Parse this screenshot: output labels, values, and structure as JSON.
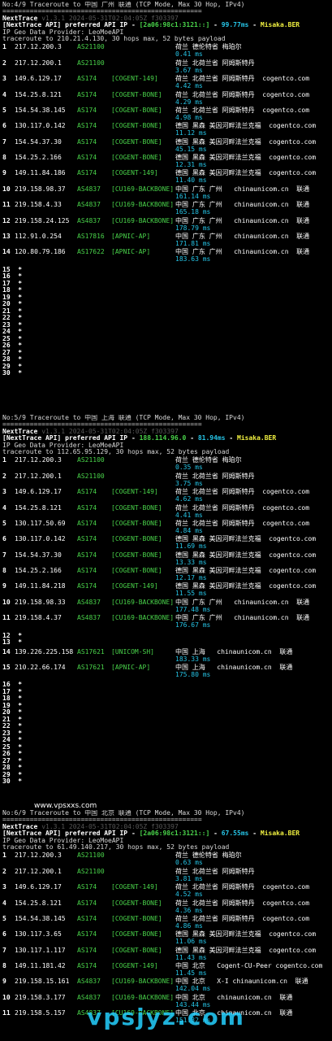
{
  "colors": {
    "background": "#000000",
    "latency": "#26c4e6",
    "asn": "#49d34a",
    "watermark": "#25d0ff"
  },
  "watermarks": {
    "small": "www.vpsxxs.com",
    "large": "vpsjyz.com"
  },
  "sections": [
    {
      "title": "No:4/9 Traceroute to 中国 广州 联通 (TCP Mode, Max 30 Hop, IPv4)",
      "separator": "===================================================",
      "brand": "NextTrace",
      "version": "v1.3.1 2024-05-31T02:04:05Z f303397",
      "api_line": "[NextTrace API] preferred API IP - [2a06:98c1:3121::] - 99.77ms - Misaka.BER",
      "provider": "IP Geo Data Provider: LeoMoeAPI",
      "trace_line": "traceroute to 210.21.4.130, 30 hops max, 52 bytes payload",
      "hops": [
        {
          "n": "1",
          "ip": "217.12.200.3",
          "asn": "AS21100",
          "tag": "",
          "geo": "荷兰 德伦特省 梅珀尔",
          "ms": "0.41 ms"
        },
        {
          "n": "2",
          "ip": "217.12.200.1",
          "asn": "AS21100",
          "tag": "",
          "geo": "荷兰 北荷兰省 阿姆斯特丹",
          "ms": "3.67 ms"
        },
        {
          "n": "3",
          "ip": "149.6.129.17",
          "asn": "AS174",
          "tag": "[COGENT-149]",
          "geo": "荷兰 北荷兰省 阿姆斯特丹  cogentco.com",
          "ms": "4.42 ms"
        },
        {
          "n": "4",
          "ip": "154.25.8.121",
          "asn": "AS174",
          "tag": "[COGENT-BONE]",
          "geo": "荷兰 北荷兰省 阿姆斯特丹  cogentco.com",
          "ms": "4.29 ms"
        },
        {
          "n": "5",
          "ip": "154.54.38.145",
          "asn": "AS174",
          "tag": "[COGENT-BONE]",
          "geo": "荷兰 北荷兰省 阿姆斯特丹  cogentco.com",
          "ms": "4.98 ms"
        },
        {
          "n": "6",
          "ip": "130.117.0.142",
          "asn": "AS174",
          "tag": "[COGENT-BONE]",
          "geo": "德国 黑森 美因河畔法兰克福  cogentco.com",
          "ms": "11.12 ms"
        },
        {
          "n": "7",
          "ip": "154.54.37.30",
          "asn": "AS174",
          "tag": "[COGENT-BONE]",
          "geo": "德国 黑森 美因河畔法兰克福  cogentco.com",
          "ms": "45.15 ms"
        },
        {
          "n": "8",
          "ip": "154.25.2.166",
          "asn": "AS174",
          "tag": "[COGENT-BONE]",
          "geo": "德国 黑森 美因河畔法兰克福  cogentco.com",
          "ms": "12.31 ms"
        },
        {
          "n": "9",
          "ip": "149.11.84.186",
          "asn": "AS174",
          "tag": "[COGENT-149]",
          "geo": "德国 黑森 美因河畔法兰克福  cogentco.com",
          "ms": "11.40 ms"
        },
        {
          "n": "10",
          "ip": "219.158.98.37",
          "asn": "AS4837",
          "tag": "[CU169-BACKBONE]",
          "geo": "中国 广东 广州   chinaunicom.cn  联通",
          "ms": "161.14 ms"
        },
        {
          "n": "11",
          "ip": "219.158.4.33",
          "asn": "AS4837",
          "tag": "[CU169-BACKBONE]",
          "geo": "中国 广东 广州   chinaunicom.cn  联通",
          "ms": "165.18 ms"
        },
        {
          "n": "12",
          "ip": "219.158.24.125",
          "asn": "AS4837",
          "tag": "[CU169-BACKBONE]",
          "geo": "中国 广东 广州   chinaunicom.cn  联通",
          "ms": "178.79 ms"
        },
        {
          "n": "13",
          "ip": "112.91.0.254",
          "asn": "AS17816",
          "tag": "[APNIC-AP]",
          "geo": "中国 广东 广州   chinaunicom.cn  联通",
          "ms": "171.81 ms"
        },
        {
          "n": "14",
          "ip": "120.80.79.186",
          "asn": "AS17622",
          "tag": "[APNIC-AP]",
          "geo": "中国 广东 广州   chinaunicom.cn  联通",
          "ms": "183.63 ms"
        }
      ],
      "stars": [
        "15",
        "16",
        "17",
        "18",
        "19",
        "20",
        "21",
        "22",
        "23",
        "24",
        "25",
        "26",
        "27",
        "28",
        "29",
        "30"
      ]
    },
    {
      "title": "No:5/9 Traceroute to 中国 上海 联通 (TCP Mode, Max 30 Hop, IPv4)",
      "separator": "===================================================",
      "brand": "NextTrace",
      "version": "v1.3.1 2024-05-31T02:04:05Z f303397",
      "api_line": "[NextTrace API] preferred API IP - 188.114.96.0 - 81.94ms - Misaka.BER",
      "provider": "IP Geo Data Provider: LeoMoeAPI",
      "trace_line": "traceroute to 112.65.95.129, 30 hops max, 52 bytes payload",
      "hops": [
        {
          "n": "1",
          "ip": "217.12.200.3",
          "asn": "AS21100",
          "tag": "",
          "geo": "荷兰 德伦特省 梅珀尔",
          "ms": "0.35 ms"
        },
        {
          "n": "2",
          "ip": "217.12.200.1",
          "asn": "AS21100",
          "tag": "",
          "geo": "荷兰 北荷兰省 阿姆斯特丹",
          "ms": "3.75 ms"
        },
        {
          "n": "3",
          "ip": "149.6.129.17",
          "asn": "AS174",
          "tag": "[COGENT-149]",
          "geo": "荷兰 北荷兰省 阿姆斯特丹  cogentco.com",
          "ms": "4.62 ms"
        },
        {
          "n": "4",
          "ip": "154.25.8.121",
          "asn": "AS174",
          "tag": "[COGENT-BONE]",
          "geo": "荷兰 北荷兰省 阿姆斯特丹  cogentco.com",
          "ms": "4.41 ms"
        },
        {
          "n": "5",
          "ip": "130.117.50.69",
          "asn": "AS174",
          "tag": "[COGENT-BONE]",
          "geo": "荷兰 北荷兰省 阿姆斯特丹  cogentco.com",
          "ms": "4.84 ms"
        },
        {
          "n": "6",
          "ip": "130.117.0.142",
          "asn": "AS174",
          "tag": "[COGENT-BONE]",
          "geo": "德国 黑森 美因河畔法兰克福  cogentco.com",
          "ms": "11.69 ms"
        },
        {
          "n": "7",
          "ip": "154.54.37.30",
          "asn": "AS174",
          "tag": "[COGENT-BONE]",
          "geo": "德国 黑森 美因河畔法兰克福  cogentco.com",
          "ms": "13.33 ms"
        },
        {
          "n": "8",
          "ip": "154.25.2.166",
          "asn": "AS174",
          "tag": "[COGENT-BONE]",
          "geo": "德国 黑森 美因河畔法兰克福  cogentco.com",
          "ms": "12.17 ms"
        },
        {
          "n": "9",
          "ip": "149.11.84.218",
          "asn": "AS174",
          "tag": "[COGENT-149]",
          "geo": "德国 黑森 美因河畔法兰克福  cogentco.com",
          "ms": "11.55 ms"
        },
        {
          "n": "10",
          "ip": "219.158.98.33",
          "asn": "AS4837",
          "tag": "[CU169-BACKBONE]",
          "geo": "中国 广东 广州   chinaunicom.cn  联通",
          "ms": "177.48 ms"
        },
        {
          "n": "11",
          "ip": "219.158.4.37",
          "asn": "AS4837",
          "tag": "[CU169-BACKBONE]",
          "geo": "中国 广东 广州   chinaunicom.cn  联通",
          "ms": "176.67 ms"
        }
      ],
      "mid_stars": [
        "12",
        "13"
      ],
      "hops_b": [
        {
          "n": "14",
          "ip": "139.226.225.158",
          "asn": "AS17621",
          "tag": "[UNICOM-SH]",
          "geo": "中国 上海   chinaunicom.cn  联通",
          "ms": "183.33 ms"
        },
        {
          "n": "15",
          "ip": "210.22.66.174",
          "asn": "AS17621",
          "tag": "[APNIC-AP]",
          "geo": "中国 上海   chinaunicom.cn  联通",
          "ms": "175.80 ms"
        }
      ],
      "stars": [
        "16",
        "17",
        "18",
        "19",
        "20",
        "21",
        "22",
        "23",
        "24",
        "25",
        "26",
        "27",
        "28",
        "29",
        "30"
      ]
    },
    {
      "title": "No:6/9 Traceroute to 中国 北京 联通 (TCP Mode, Max 30 Hop, IPv4)",
      "separator": "===================================================",
      "brand": "NextTrace",
      "version": "v1.3.1 2024-05-31T02:04:05Z f303397",
      "api_line": "[NextTrace API] preferred API IP - [2a06:98c1:3121::] - 67.55ms - Misaka.BER",
      "provider": "IP Geo Data Provider: LeoMoeAPI",
      "trace_line": "traceroute to 61.49.140.217, 30 hops max, 52 bytes payload",
      "hops": [
        {
          "n": "1",
          "ip": "217.12.200.3",
          "asn": "AS21100",
          "tag": "",
          "geo": "荷兰 德伦特省 梅珀尔",
          "ms": "0.63 ms"
        },
        {
          "n": "2",
          "ip": "217.12.200.1",
          "asn": "AS21100",
          "tag": "",
          "geo": "荷兰 北荷兰省 阿姆斯特丹",
          "ms": "3.81 ms"
        },
        {
          "n": "3",
          "ip": "149.6.129.17",
          "asn": "AS174",
          "tag": "[COGENT-149]",
          "geo": "荷兰 北荷兰省 阿姆斯特丹  cogentco.com",
          "ms": "4.52 ms"
        },
        {
          "n": "4",
          "ip": "154.25.8.121",
          "asn": "AS174",
          "tag": "[COGENT-BONE]",
          "geo": "荷兰 北荷兰省 阿姆斯特丹  cogentco.com",
          "ms": "4.36 ms"
        },
        {
          "n": "5",
          "ip": "154.54.38.145",
          "asn": "AS174",
          "tag": "[COGENT-BONE]",
          "geo": "荷兰 北荷兰省 阿姆斯特丹  cogentco.com",
          "ms": "4.86 ms"
        },
        {
          "n": "6",
          "ip": "130.117.3.65",
          "asn": "AS174",
          "tag": "[COGENT-BONE]",
          "geo": "德国 黑森 美因河畔法兰克福  cogentco.com",
          "ms": "11.06 ms"
        },
        {
          "n": "7",
          "ip": "130.117.1.117",
          "asn": "AS174",
          "tag": "[COGENT-BONE]",
          "geo": "德国 黑森 美因河畔法兰克福  cogentco.com",
          "ms": "11.43 ms"
        },
        {
          "n": "8",
          "ip": "149.11.181.42",
          "asn": "AS174",
          "tag": "[COGENT-149]",
          "geo": "中国 北京   Cogent-CU-Peer cogentco.com",
          "ms": "11.45 ms"
        },
        {
          "n": "9",
          "ip": "219.158.15.161",
          "asn": "AS4837",
          "tag": "[CU169-BACKBONE]",
          "geo": "中国 北京   X-I chinaunicom.cn  联通",
          "ms": "142.04 ms"
        },
        {
          "n": "10",
          "ip": "219.158.3.177",
          "asn": "AS4837",
          "tag": "[CU169-BACKBONE]",
          "geo": "中国 北京   chinaunicom.cn  联通",
          "ms": "143.44 ms"
        },
        {
          "n": "11",
          "ip": "219.158.5.157",
          "asn": "AS4837",
          "tag": "[CU169-BACKBONE]",
          "geo": "中国 北京   chinaunicom.cn  联通",
          "ms": "151.32 ms"
        }
      ]
    }
  ]
}
